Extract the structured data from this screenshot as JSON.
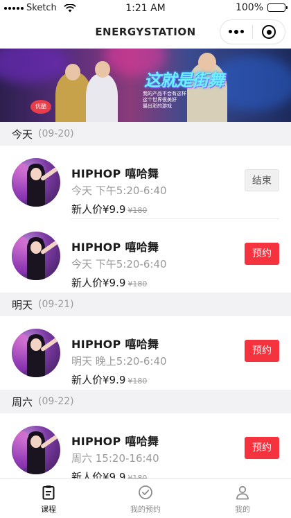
{
  "status_bar": {
    "carrier": "Sketch",
    "time": "1:21 AM",
    "battery": "100%"
  },
  "nav": {
    "title": "ENERGYSTATION"
  },
  "banner": {
    "show_title": "这就是街舞",
    "subtitle_lines": [
      "我的产品不会有这样",
      "这个世界很美好",
      "最出彩的游戏"
    ],
    "badge": "优酷"
  },
  "sections": [
    {
      "day": "今天",
      "date": "(09-20)",
      "classes": [
        {
          "title": "HIPHOP 嘻哈舞",
          "time": "今天 下午5:20-6:40",
          "price_label": "新人价¥9.9",
          "original_price": "¥180",
          "action": "结束",
          "status": "ended"
        },
        {
          "title": "HIPHOP 嘻哈舞",
          "time": "今天 下午5:20-6:40",
          "price_label": "新人价¥9.9",
          "original_price": "¥180",
          "action": "预约",
          "status": "open"
        }
      ]
    },
    {
      "day": "明天",
      "date": "(09-21)",
      "classes": [
        {
          "title": "HIPHOP 嘻哈舞",
          "time": "明天 晚上5:20-6:40",
          "price_label": "新人价¥9.9",
          "original_price": "¥180",
          "action": "预约",
          "status": "open"
        }
      ]
    },
    {
      "day": "周六",
      "date": "(09-22)",
      "classes": [
        {
          "title": "HIPHOP 嘻哈舞",
          "time": "周六 15:20-16:40",
          "price_label": "新人价¥9.9",
          "original_price": "¥180",
          "action": "预约",
          "status": "open"
        }
      ]
    }
  ],
  "tabs": [
    {
      "label": "课程",
      "icon": "clipboard-icon",
      "active": true
    },
    {
      "label": "我的预约",
      "icon": "check-circle-icon",
      "active": false
    },
    {
      "label": "我的",
      "icon": "user-icon",
      "active": false
    }
  ],
  "colors": {
    "accent": "#f5333f",
    "section_bg": "#f2f2f4",
    "muted_text": "#9a9a9a"
  }
}
